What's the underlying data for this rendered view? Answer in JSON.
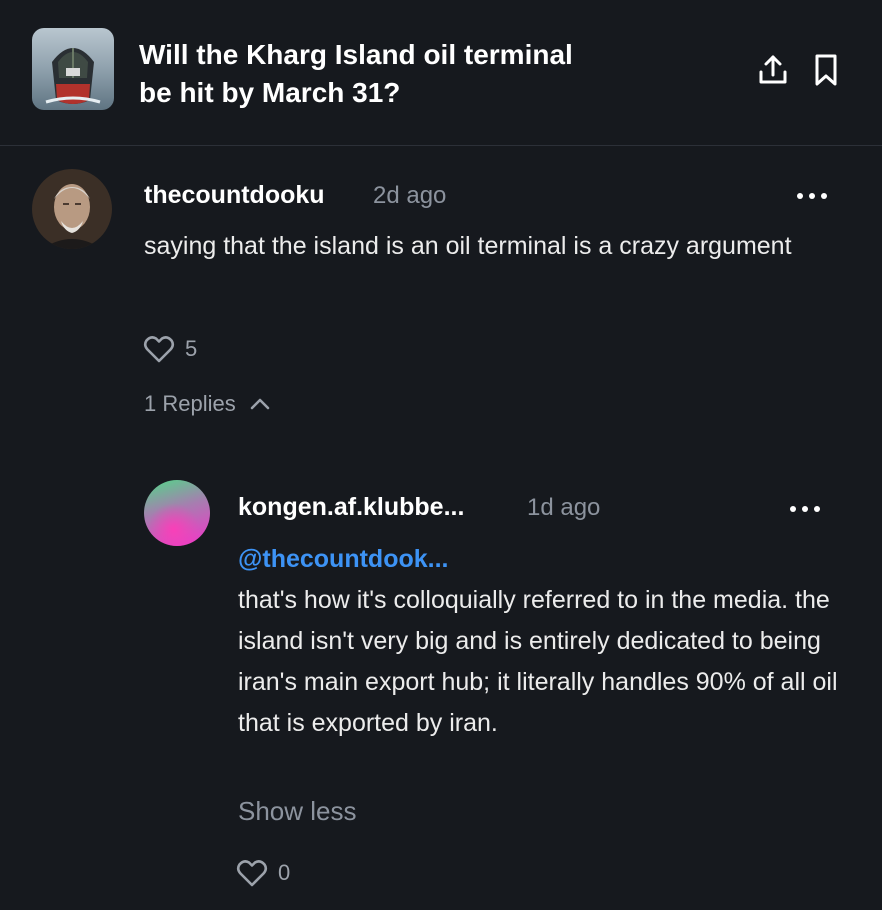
{
  "header": {
    "title": "Will the Kharg Island oil terminal be hit by March 31?",
    "share_icon": "share-upload-icon",
    "bookmark_icon": "bookmark-icon"
  },
  "comment": {
    "username": "thecountdooku",
    "time": "2d ago",
    "text": "saying that the island is an oil terminal is a crazy argument",
    "likes": "5",
    "replies_label": "1 Replies"
  },
  "reply": {
    "username": "kongen.af.klubbe...",
    "time": "1d ago",
    "mention": "@thecountdook...",
    "text": "that's how it's colloquially referred to in the media. the island isn't very big and is entirely dedicated to being iran's main export hub; it literally handles 90% of all oil that is exported by iran.",
    "show_less": "Show less",
    "likes": "0"
  },
  "colors": {
    "background": "#16191e",
    "mention": "#3d93f5",
    "muted": "#8c939e"
  }
}
